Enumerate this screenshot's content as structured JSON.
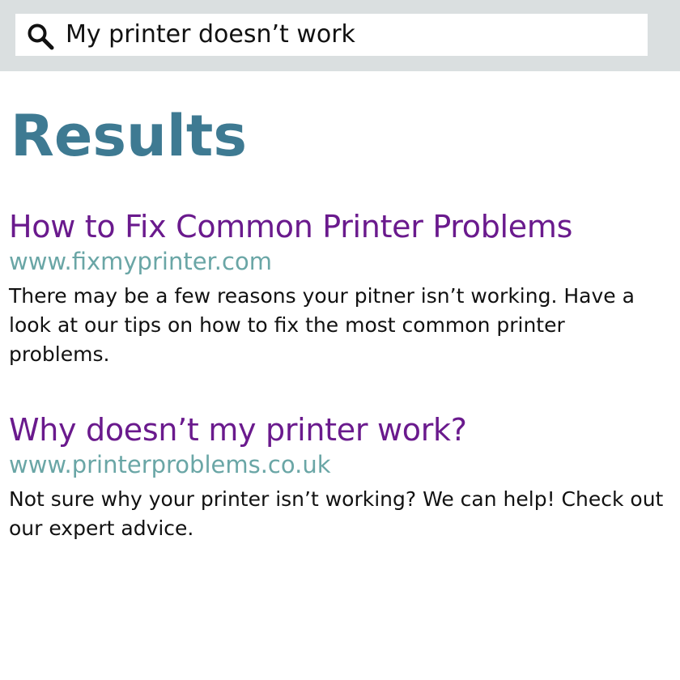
{
  "search": {
    "query": "My printer doesn’t work",
    "icon": "search-icon"
  },
  "page": {
    "title": "Results"
  },
  "results": [
    {
      "title": "How to Fix Common Printer Problems",
      "url": "www.fixmyprinter.com",
      "snippet": "There may be a few reasons your pitner isn’t working. Have a look at our tips on how to fix the most common printer problems."
    },
    {
      "title": "Why doesn’t my printer work?",
      "url": "www.printerproblems.co.uk",
      "snippet": "Not sure why your printer isn’t working? We can help! Check out our expert advice."
    }
  ],
  "colors": {
    "header_background": "#dadfe0",
    "title": "#3e7a92",
    "link": "#6a1a8d",
    "url": "#6aa6a6",
    "text": "#111111"
  }
}
